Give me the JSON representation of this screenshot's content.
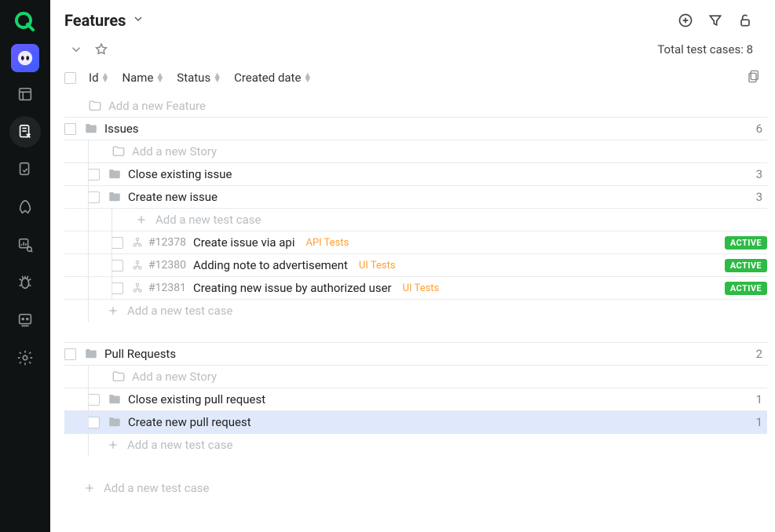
{
  "page_title": "Features",
  "total_label": "Total test cases: ",
  "total_count": "8",
  "columns": {
    "id": "Id",
    "name": "Name",
    "status": "Status",
    "created": "Created date"
  },
  "placeholders": {
    "new_feature": "Add a new Feature",
    "new_story": "Add a new Story",
    "new_testcase": "Add a new test case"
  },
  "groups": [
    {
      "name": "Issues",
      "count": "6",
      "stories": [
        {
          "name": "Close existing issue",
          "count": "3",
          "testcases": []
        },
        {
          "name": "Create new issue",
          "count": "3",
          "testcases": [
            {
              "id": "#12378",
              "name": "Create issue via api",
              "tag": "API Tests",
              "tag_class": "tag-api",
              "status": "ACTIVE"
            },
            {
              "id": "#12380",
              "name": "Adding note to advertisement",
              "tag": "UI Tests",
              "tag_class": "tag-ui",
              "status": "ACTIVE"
            },
            {
              "id": "#12381",
              "name": "Creating new issue by authorized user",
              "tag": "UI Tests",
              "tag_class": "tag-ui",
              "status": "ACTIVE"
            }
          ]
        }
      ]
    },
    {
      "name": "Pull Requests",
      "count": "2",
      "stories": [
        {
          "name": "Close existing pull request",
          "count": "1",
          "testcases": []
        },
        {
          "name": "Create new pull request",
          "count": "1",
          "testcases": [],
          "selected": true
        }
      ]
    }
  ]
}
